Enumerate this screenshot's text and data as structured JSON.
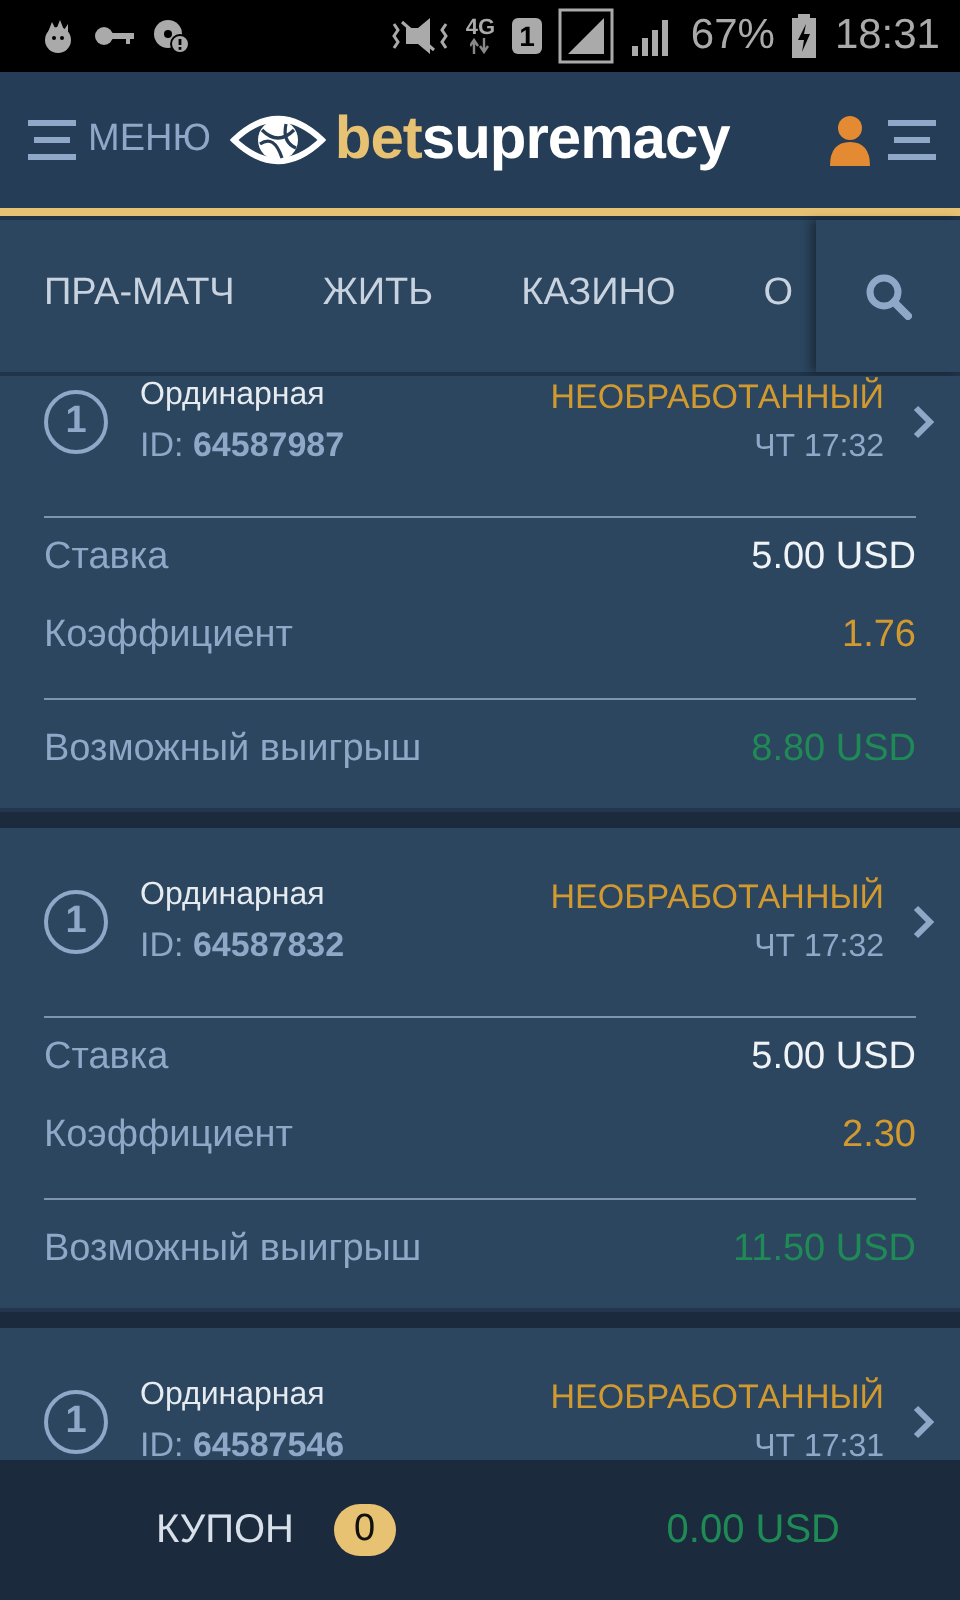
{
  "status_bar": {
    "network": "4G",
    "sim": "1",
    "battery": "67%",
    "time": "18:31"
  },
  "header": {
    "menu_label": "МЕНЮ",
    "logo_prefix": "bet",
    "logo_suffix": "supremacy"
  },
  "tabs": [
    {
      "label": "ПРА-МАТЧ",
      "selected": false
    },
    {
      "label": "ЖИТЬ",
      "selected": false
    },
    {
      "label": "КАЗИНО",
      "selected": false
    },
    {
      "label": "О",
      "selected": false
    }
  ],
  "bets": [
    {
      "count": "1",
      "type": "Ординарная",
      "id_label": "ID:",
      "id": "64587987",
      "status": "НЕОБРАБОТАННЫЙ",
      "time": "ЧТ 17:32",
      "rows": [
        {
          "kind": "stake",
          "label": "Ставка",
          "value": "5.00 USD"
        },
        {
          "kind": "odds",
          "label": "Коэффициент",
          "value": "1.76"
        },
        {
          "kind": "payout",
          "label": "Возможный выигрыш",
          "value": "8.80 USD"
        }
      ]
    },
    {
      "count": "1",
      "type": "Ординарная",
      "id_label": "ID:",
      "id": "64587832",
      "status": "НЕОБРАБОТАННЫЙ",
      "time": "ЧТ 17:32",
      "rows": [
        {
          "kind": "stake",
          "label": "Ставка",
          "value": "5.00 USD"
        },
        {
          "kind": "odds",
          "label": "Коэффициент",
          "value": "2.30"
        },
        {
          "kind": "payout",
          "label": "Возможный выигрыш",
          "value": "11.50 USD"
        }
      ]
    },
    {
      "count": "1",
      "type": "Ординарная",
      "id_label": "ID:",
      "id": "64587546",
      "status": "НЕОБРАБОТАННЫЙ",
      "time": "ЧТ 17:31"
    }
  ],
  "footer": {
    "label": "КУПОН",
    "count": "0",
    "total": "0.00 USD"
  }
}
